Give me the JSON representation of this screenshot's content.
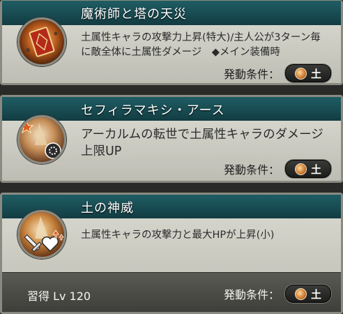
{
  "skills": [
    {
      "title": "魔術師と塔の天災",
      "description": "土属性キャラの攻撃力上昇(特大)/主人公が3ターン毎に敵全体に土属性ダメージ　◆メイン装備時",
      "condition_label": "発動条件：",
      "element": "土"
    },
    {
      "title": "セフィラマキシ・アース",
      "description": "アーカルムの転世で土属性キャラのダメージ上限UP",
      "condition_label": "発動条件：",
      "element": "土"
    },
    {
      "title": "土の神威",
      "description": "土属性キャラの攻撃力と最大HPが上昇(小)",
      "condition_label": "発動条件：",
      "element": "土",
      "learn_label": "習得 Lv 120"
    }
  ],
  "colors": {
    "title_bar": "#174a50",
    "panel_bg": "#cfcfc6",
    "element_earth": "#c9762a"
  }
}
